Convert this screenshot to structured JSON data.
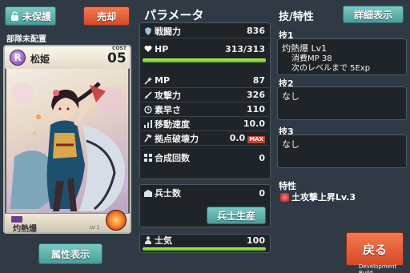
{
  "left": {
    "lock_button": "未保護",
    "sell_button": "売却",
    "deploy_status": "部隊未配置",
    "card": {
      "rarity": "R",
      "name": "松姫",
      "cost_label": "COST",
      "cost": "05",
      "skill_tag": "技",
      "skill_name": "灼熱爆",
      "level_mini": "LV 1"
    },
    "attribute_button": "属性表示"
  },
  "params": {
    "title": "パラメータ",
    "power": {
      "label": "戦闘力",
      "value": "836",
      "icon": "shield-icon"
    },
    "hp": {
      "label": "HP",
      "value": "313/313",
      "fill": 1.0,
      "icon": "heart-icon"
    },
    "mp": {
      "label": "MP",
      "value": "87",
      "icon": "wand-icon"
    },
    "attack": {
      "label": "攻撃力",
      "value": "326",
      "icon": "sword-icon"
    },
    "speed": {
      "label": "素早さ",
      "value": "110",
      "icon": "clock-icon"
    },
    "move": {
      "label": "移動速度",
      "value": "10.0",
      "icon": "boot-icon"
    },
    "break": {
      "label": "拠点破壊力",
      "value": "0.0",
      "max_badge": "MAX",
      "icon": "hammer-icon"
    },
    "fusion": {
      "label": "合成回数",
      "value": "0",
      "icon": "grid-icon"
    },
    "soldiers": {
      "label": "兵士数",
      "value": "0",
      "icon": "soldier-icon"
    },
    "produce_button": "兵士生産",
    "morale": {
      "label": "士気",
      "value": "100",
      "fill": 1.0,
      "icon": "person-icon"
    }
  },
  "skills": {
    "title": "技/特性",
    "detail_button": "詳細表示",
    "skill1": {
      "head": "技1",
      "name": "灼熱爆 Lv1",
      "mp_cost": "消費MP 38",
      "next": "次のレベルまで 5Exp"
    },
    "skill2": {
      "head": "技2",
      "text": "なし"
    },
    "skill3": {
      "head": "技3",
      "text": "なし"
    },
    "trait": {
      "head": "特性",
      "text": "土攻撃上昇Lv.3"
    },
    "back_button": "戻る",
    "build_label": "Development Build"
  },
  "colors": {
    "background": "#2f3a45",
    "teal_button": "#5aaba7",
    "red_button": "#e05a34",
    "bar_green": "#7fd22e",
    "rarity_purple": "#8a4fb8"
  }
}
